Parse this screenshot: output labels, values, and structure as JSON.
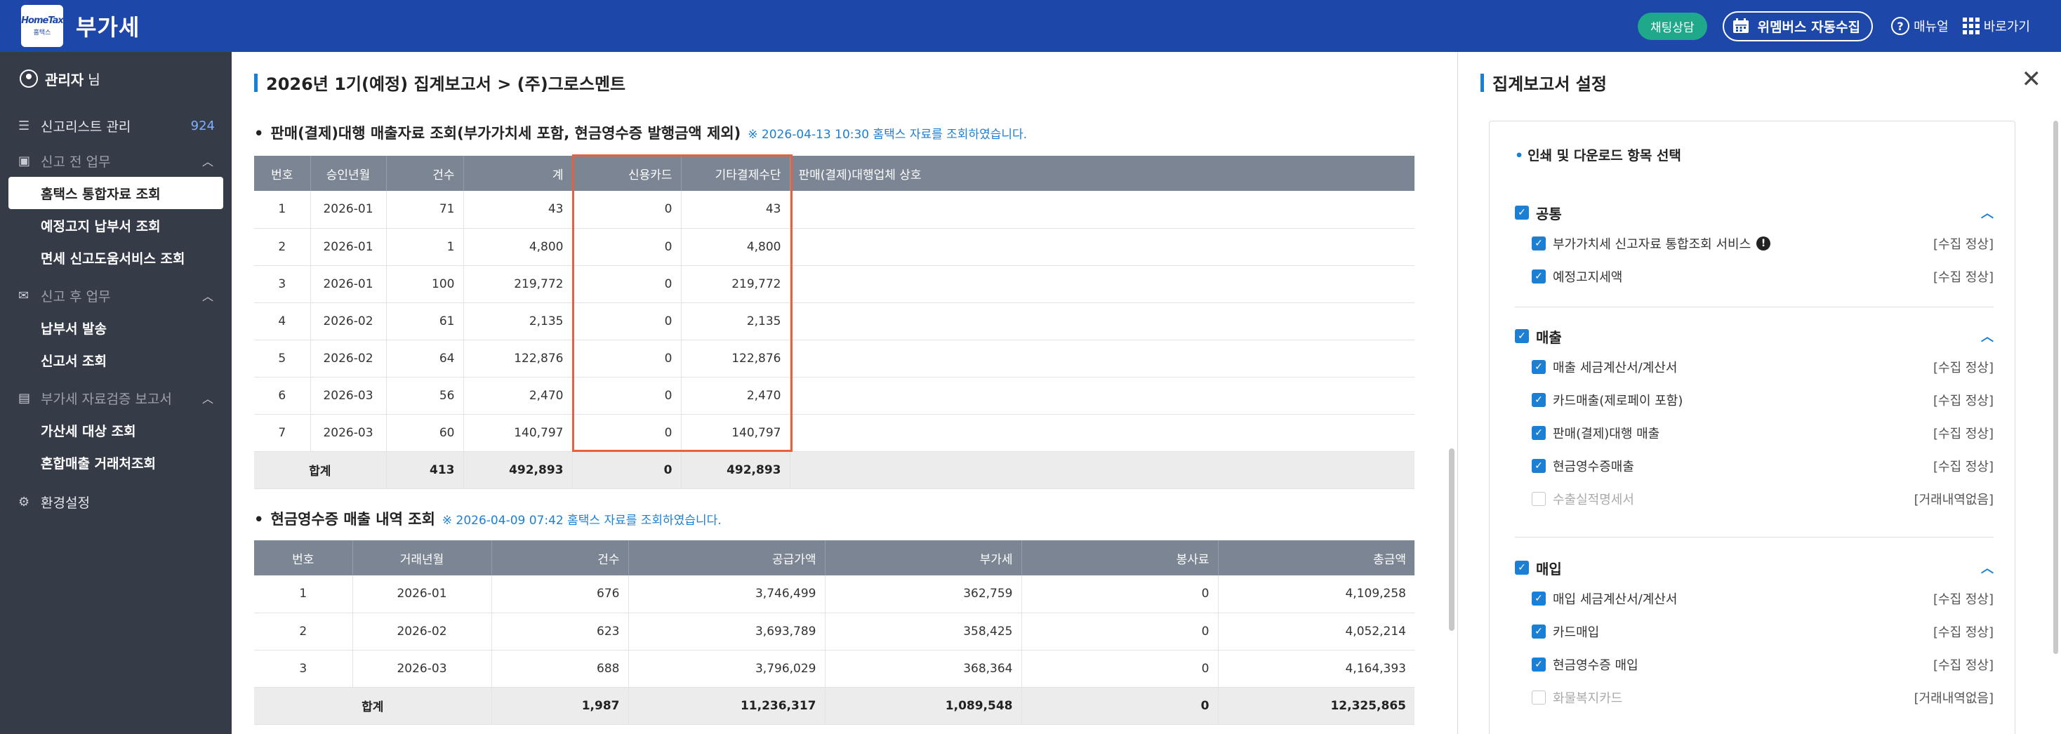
{
  "header": {
    "logo_text": "HomeTax",
    "logo_sub": "홈택스",
    "title": "부가세",
    "chat_label": "채팅상담",
    "auto_collect_label": "위멤버스 자동수집",
    "manual_label": "매뉴얼",
    "shortcut_label": "바로가기"
  },
  "sidebar": {
    "user_name": "관리자",
    "user_suffix": "님",
    "report_list": {
      "label": "신고리스트 관리",
      "count": "924"
    },
    "groups": [
      {
        "label": "신고 전 업무",
        "items": [
          "홈택스 통합자료 조회",
          "예정고지 납부서 조회",
          "면세 신고도움서비스 조회"
        ]
      },
      {
        "label": "신고 후 업무",
        "items": [
          "납부서 발송",
          "신고서 조회"
        ]
      },
      {
        "label": "부가세 자료검증 보고서",
        "items": [
          "가산세 대상 조회",
          "혼합매출 거래처조회"
        ]
      }
    ],
    "settings_label": "환경설정"
  },
  "main": {
    "title": "2026년 1기(예정) 집계보고서 > (주)그로스멘트",
    "section1": {
      "title": "판매(결제)대행 매출자료 조회(부가가치세 포함, 현금영수증 발행금액 제외)",
      "note": "※ 2026-04-13 10:30 홈택스 자료를 조회하였습니다.",
      "columns": [
        "번호",
        "승인년월",
        "건수",
        "계",
        "신용카드",
        "기타결제수단",
        "판매(결제)대행업체 상호"
      ],
      "rows": [
        [
          "1",
          "2026-01",
          "71",
          "43",
          "0",
          "43",
          ""
        ],
        [
          "2",
          "2026-01",
          "1",
          "4,800",
          "0",
          "4,800",
          ""
        ],
        [
          "3",
          "2026-01",
          "100",
          "219,772",
          "0",
          "219,772",
          ""
        ],
        [
          "4",
          "2026-02",
          "61",
          "2,135",
          "0",
          "2,135",
          ""
        ],
        [
          "5",
          "2026-02",
          "64",
          "122,876",
          "0",
          "122,876",
          ""
        ],
        [
          "6",
          "2026-03",
          "56",
          "2,470",
          "0",
          "2,470",
          ""
        ],
        [
          "7",
          "2026-03",
          "60",
          "140,797",
          "0",
          "140,797",
          ""
        ]
      ],
      "total": [
        "합계",
        "413",
        "492,893",
        "0",
        "492,893",
        ""
      ]
    },
    "section2": {
      "title": "현금영수증 매출 내역 조회",
      "note": "※ 2026-04-09 07:42 홈택스 자료를 조회하였습니다.",
      "columns": [
        "번호",
        "거래년월",
        "건수",
        "공급가액",
        "부가세",
        "봉사료",
        "총금액"
      ],
      "rows": [
        [
          "1",
          "2026-01",
          "676",
          "3,746,499",
          "362,759",
          "0",
          "4,109,258"
        ],
        [
          "2",
          "2026-02",
          "623",
          "3,693,789",
          "358,425",
          "0",
          "4,052,214"
        ],
        [
          "3",
          "2026-03",
          "688",
          "3,796,029",
          "368,364",
          "0",
          "4,164,393"
        ]
      ],
      "total": [
        "합계",
        "1,987",
        "11,236,317",
        "1,089,548",
        "0",
        "12,325,865"
      ]
    }
  },
  "panel": {
    "title": "집계보고서 설정",
    "options_heading": "인쇄 및 다운로드 항목 선택",
    "groups": [
      {
        "label": "공통",
        "items": [
          {
            "label": "부가가치세 신고자료 통합조회 서비스",
            "status": "[수집 정상]",
            "checked": true,
            "warn": true
          },
          {
            "label": "예정고지세액",
            "status": "[수집 정상]",
            "checked": true
          }
        ]
      },
      {
        "label": "매출",
        "items": [
          {
            "label": "매출 세금계산서/계산서",
            "status": "[수집 정상]",
            "checked": true
          },
          {
            "label": "카드매출(제로페이 포함)",
            "status": "[수집 정상]",
            "checked": true
          },
          {
            "label": "판매(결제)대행 매출",
            "status": "[수집 정상]",
            "checked": true
          },
          {
            "label": "현금영수증매출",
            "status": "[수집 정상]",
            "checked": true
          },
          {
            "label": "수출실적명세서",
            "status": "[거래내역없음]",
            "checked": false
          }
        ]
      },
      {
        "label": "매입",
        "items": [
          {
            "label": "매입 세금계산서/계산서",
            "status": "[수집 정상]",
            "checked": true
          },
          {
            "label": "카드매입",
            "status": "[수집 정상]",
            "checked": true
          },
          {
            "label": "현금영수증 매입",
            "status": "[수집 정상]",
            "checked": true
          },
          {
            "label": "화물복지카드",
            "status": "[거래내역없음]",
            "checked": false
          }
        ]
      }
    ]
  },
  "colors": {
    "header": "#1d47a8",
    "sidebar": "#363b48",
    "accent": "#1b7fd4",
    "highlight": "#e8603c",
    "table_header": "#7b8593"
  }
}
